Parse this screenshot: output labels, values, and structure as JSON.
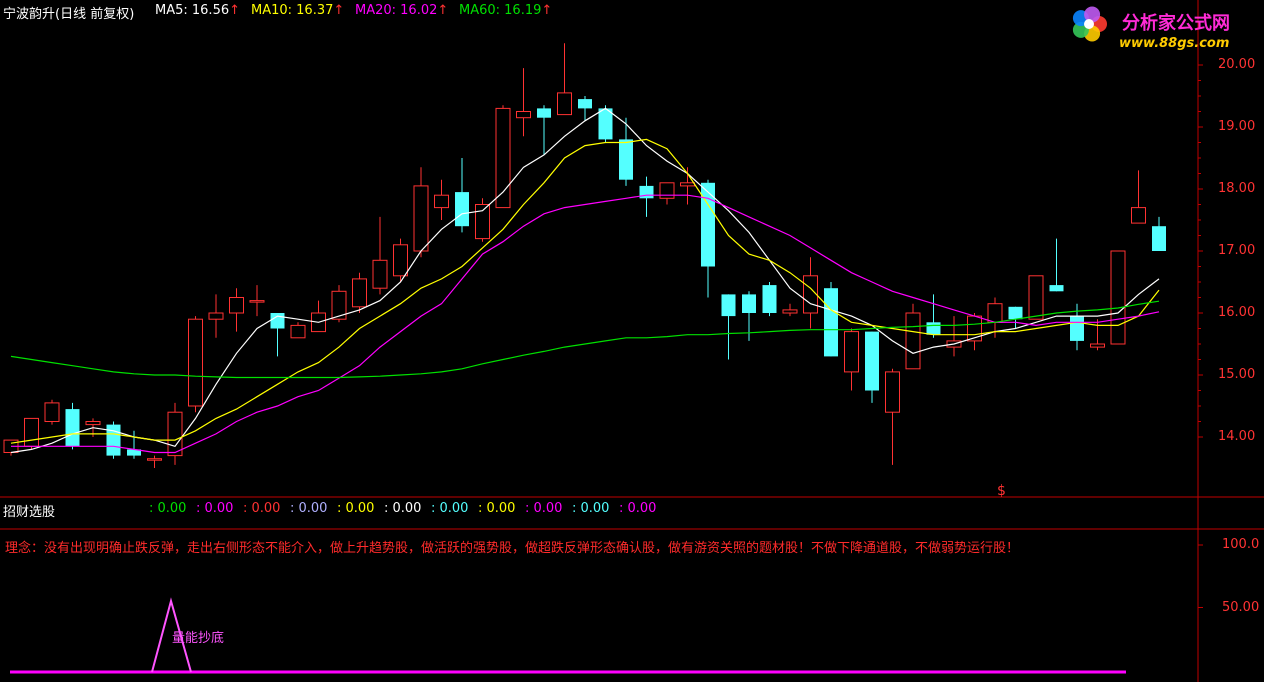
{
  "header": {
    "title": "宁波韵升(日线 前复权)",
    "ma5_label": "MA5: 16.56",
    "ma10_label": "MA10: 16.37",
    "ma20_label": "MA20: 16.02",
    "ma60_label": "MA60: 16.19",
    "arrow": "↑"
  },
  "colors": {
    "up": "#ff3232",
    "down": "#54ffff",
    "ma5": "#ffffff",
    "ma10": "#ffff00",
    "ma20": "#ff00ff",
    "ma60": "#00e000",
    "axis": "#c00000"
  },
  "watermark": {
    "brand": "分析家公式网",
    "url": "www.88gs.com"
  },
  "indicator": {
    "name": "招财选股",
    "values": [
      {
        "text": ": 0.00",
        "color": "#00e000"
      },
      {
        "text": ": 0.00",
        "color": "#ff00ff"
      },
      {
        "text": ": 0.00",
        "color": "#ff3232"
      },
      {
        "text": ": 0.00",
        "color": "#b0b0ff"
      },
      {
        "text": ": 0.00",
        "color": "#ffff00"
      },
      {
        "text": ": 0.00",
        "color": "#ffffff"
      },
      {
        "text": ": 0.00",
        "color": "#54ffff"
      },
      {
        "text": ": 0.00",
        "color": "#ffff00"
      },
      {
        "text": ": 0.00",
        "color": "#ff00ff"
      },
      {
        "text": ": 0.00",
        "color": "#54ffff"
      },
      {
        "text": ": 0.00",
        "color": "#ff00ff"
      }
    ],
    "note": "理念：没有出现明确止跌反弹，走出右侧形态不能介入，做上升趋势股，做活跃的强势股，做超跌反弹形态确认股，做有游资关照的题材股！不做下降通道股，不做弱势运行股！",
    "signal_label": "量能抄底",
    "marker": "$"
  },
  "chart_data": {
    "type": "candlestick",
    "title": "宁波韵升(日线 前复权)",
    "ylim": [
      13.5,
      20.2
    ],
    "yticks": [
      "20.00",
      "19.00",
      "18.00",
      "17.00",
      "16.00",
      "15.00",
      "14.00"
    ],
    "candles": [
      {
        "o": 13.75,
        "h": 13.95,
        "l": 13.7,
        "c": 13.95
      },
      {
        "o": 13.85,
        "h": 14.3,
        "l": 13.8,
        "c": 14.3
      },
      {
        "o": 14.25,
        "h": 14.6,
        "l": 14.2,
        "c": 14.55
      },
      {
        "o": 14.45,
        "h": 14.55,
        "l": 13.8,
        "c": 13.85
      },
      {
        "o": 14.2,
        "h": 14.3,
        "l": 14.0,
        "c": 14.25
      },
      {
        "o": 14.2,
        "h": 14.25,
        "l": 13.65,
        "c": 13.7
      },
      {
        "o": 13.8,
        "h": 14.1,
        "l": 13.65,
        "c": 13.7
      },
      {
        "o": 13.65,
        "h": 13.7,
        "l": 13.5,
        "c": 13.65
      },
      {
        "o": 13.7,
        "h": 14.55,
        "l": 13.55,
        "c": 14.4
      },
      {
        "o": 14.5,
        "h": 15.95,
        "l": 14.4,
        "c": 15.9
      },
      {
        "o": 15.9,
        "h": 16.3,
        "l": 15.6,
        "c": 16.0
      },
      {
        "o": 16.0,
        "h": 16.4,
        "l": 15.7,
        "c": 16.25
      },
      {
        "o": 16.2,
        "h": 16.45,
        "l": 15.95,
        "c": 16.2
      },
      {
        "o": 16.0,
        "h": 16.0,
        "l": 15.3,
        "c": 15.75
      },
      {
        "o": 15.6,
        "h": 15.85,
        "l": 15.6,
        "c": 15.8
      },
      {
        "o": 15.7,
        "h": 16.2,
        "l": 15.7,
        "c": 16.0
      },
      {
        "o": 15.9,
        "h": 16.45,
        "l": 15.85,
        "c": 16.35
      },
      {
        "o": 16.1,
        "h": 16.65,
        "l": 16.0,
        "c": 16.55
      },
      {
        "o": 16.4,
        "h": 17.55,
        "l": 16.3,
        "c": 16.85
      },
      {
        "o": 16.6,
        "h": 17.2,
        "l": 16.5,
        "c": 17.1
      },
      {
        "o": 17.0,
        "h": 18.35,
        "l": 16.9,
        "c": 18.05
      },
      {
        "o": 17.7,
        "h": 18.15,
        "l": 17.5,
        "c": 17.9
      },
      {
        "o": 17.95,
        "h": 18.5,
        "l": 17.3,
        "c": 17.4
      },
      {
        "o": 17.2,
        "h": 17.85,
        "l": 17.15,
        "c": 17.75
      },
      {
        "o": 17.7,
        "h": 19.35,
        "l": 17.7,
        "c": 19.3
      },
      {
        "o": 19.15,
        "h": 19.95,
        "l": 18.85,
        "c": 19.25
      },
      {
        "o": 19.3,
        "h": 19.35,
        "l": 18.55,
        "c": 19.15
      },
      {
        "o": 19.2,
        "h": 20.35,
        "l": 19.2,
        "c": 19.55
      },
      {
        "o": 19.45,
        "h": 19.5,
        "l": 19.1,
        "c": 19.3
      },
      {
        "o": 19.3,
        "h": 19.35,
        "l": 18.75,
        "c": 18.8
      },
      {
        "o": 18.8,
        "h": 19.15,
        "l": 18.05,
        "c": 18.15
      },
      {
        "o": 18.05,
        "h": 18.2,
        "l": 17.55,
        "c": 17.85
      },
      {
        "o": 17.85,
        "h": 18.1,
        "l": 17.75,
        "c": 18.1
      },
      {
        "o": 18.05,
        "h": 18.35,
        "l": 17.75,
        "c": 18.1
      },
      {
        "o": 18.1,
        "h": 18.15,
        "l": 16.25,
        "c": 16.75
      },
      {
        "o": 16.3,
        "h": 16.3,
        "l": 15.25,
        "c": 15.95
      },
      {
        "o": 16.3,
        "h": 16.35,
        "l": 15.55,
        "c": 16.0
      },
      {
        "o": 16.45,
        "h": 16.5,
        "l": 15.95,
        "c": 16.0
      },
      {
        "o": 16.0,
        "h": 16.15,
        "l": 15.95,
        "c": 16.05
      },
      {
        "o": 16.0,
        "h": 16.9,
        "l": 15.75,
        "c": 16.6
      },
      {
        "o": 16.4,
        "h": 16.5,
        "l": 15.3,
        "c": 15.3
      },
      {
        "o": 15.05,
        "h": 15.75,
        "l": 14.75,
        "c": 15.7
      },
      {
        "o": 15.7,
        "h": 15.7,
        "l": 14.55,
        "c": 14.75
      },
      {
        "o": 14.4,
        "h": 15.1,
        "l": 13.55,
        "c": 15.05
      },
      {
        "o": 15.1,
        "h": 16.15,
        "l": 15.1,
        "c": 16.0
      },
      {
        "o": 15.85,
        "h": 16.3,
        "l": 15.6,
        "c": 15.65
      },
      {
        "o": 15.45,
        "h": 15.95,
        "l": 15.3,
        "c": 15.55
      },
      {
        "o": 15.55,
        "h": 16.0,
        "l": 15.4,
        "c": 15.95
      },
      {
        "o": 15.85,
        "h": 16.25,
        "l": 15.6,
        "c": 16.15
      },
      {
        "o": 16.1,
        "h": 16.1,
        "l": 15.75,
        "c": 15.9
      },
      {
        "o": 15.9,
        "h": 16.35,
        "l": 15.9,
        "c": 16.6
      },
      {
        "o": 16.45,
        "h": 17.2,
        "l": 16.35,
        "c": 16.35
      },
      {
        "o": 15.95,
        "h": 16.15,
        "l": 15.4,
        "c": 15.55
      },
      {
        "o": 15.45,
        "h": 15.9,
        "l": 15.4,
        "c": 15.5
      },
      {
        "o": 15.5,
        "h": 17.0,
        "l": 15.5,
        "c": 17.0
      },
      {
        "o": 17.45,
        "h": 18.3,
        "l": 17.45,
        "c": 17.7
      },
      {
        "o": 17.4,
        "h": 17.55,
        "l": 17.0,
        "c": 17.0
      }
    ],
    "series": [
      {
        "name": "MA5",
        "values": [
          13.75,
          13.8,
          13.9,
          14.05,
          14.15,
          14.1,
          14.0,
          13.95,
          13.85,
          14.3,
          14.85,
          15.35,
          15.75,
          15.95,
          15.9,
          15.85,
          15.95,
          16.05,
          16.2,
          16.5,
          17.0,
          17.35,
          17.6,
          17.65,
          17.95,
          18.35,
          18.55,
          18.85,
          19.1,
          19.3,
          19.05,
          18.7,
          18.45,
          18.25,
          17.95,
          17.65,
          17.3,
          16.85,
          16.4,
          16.15,
          16.05,
          15.95,
          15.8,
          15.55,
          15.35,
          15.45,
          15.5,
          15.6,
          15.7,
          15.75,
          15.85,
          15.95,
          15.95,
          15.95,
          16.0,
          16.3,
          16.55
        ]
      },
      {
        "name": "MA10",
        "values": [
          13.9,
          13.95,
          14.0,
          14.05,
          14.05,
          14.05,
          14.0,
          13.95,
          13.95,
          14.1,
          14.3,
          14.45,
          14.65,
          14.85,
          15.05,
          15.2,
          15.45,
          15.75,
          15.95,
          16.15,
          16.4,
          16.55,
          16.75,
          17.05,
          17.35,
          17.75,
          18.1,
          18.5,
          18.7,
          18.75,
          18.75,
          18.8,
          18.65,
          18.25,
          17.75,
          17.25,
          16.95,
          16.85,
          16.65,
          16.4,
          16.05,
          15.85,
          15.8,
          15.75,
          15.7,
          15.65,
          15.65,
          15.65,
          15.7,
          15.7,
          15.75,
          15.8,
          15.85,
          15.8,
          15.8,
          15.95,
          16.37
        ]
      },
      {
        "name": "MA20",
        "values": [
          13.85,
          13.85,
          13.85,
          13.85,
          13.85,
          13.85,
          13.8,
          13.75,
          13.75,
          13.9,
          14.05,
          14.25,
          14.4,
          14.5,
          14.65,
          14.75,
          14.95,
          15.15,
          15.45,
          15.7,
          15.95,
          16.15,
          16.55,
          16.95,
          17.15,
          17.4,
          17.6,
          17.7,
          17.75,
          17.8,
          17.85,
          17.9,
          17.9,
          17.9,
          17.85,
          17.7,
          17.55,
          17.4,
          17.25,
          17.05,
          16.85,
          16.65,
          16.5,
          16.35,
          16.25,
          16.15,
          16.05,
          15.95,
          15.85,
          15.85,
          15.8,
          15.85,
          15.85,
          15.85,
          15.9,
          15.95,
          16.02
        ]
      },
      {
        "name": "MA60",
        "values": [
          15.3,
          15.25,
          15.2,
          15.15,
          15.1,
          15.05,
          15.02,
          15.0,
          15.0,
          14.98,
          14.97,
          14.96,
          14.96,
          14.96,
          14.96,
          14.96,
          14.96,
          14.97,
          14.98,
          15.0,
          15.02,
          15.05,
          15.1,
          15.18,
          15.25,
          15.32,
          15.38,
          15.45,
          15.5,
          15.55,
          15.6,
          15.6,
          15.62,
          15.65,
          15.65,
          15.67,
          15.68,
          15.7,
          15.72,
          15.73,
          15.73,
          15.73,
          15.75,
          15.77,
          15.78,
          15.8,
          15.8,
          15.82,
          15.85,
          15.9,
          15.95,
          16.0,
          16.03,
          16.05,
          16.08,
          16.14,
          16.19
        ]
      }
    ],
    "indicator_yticks": [
      "100.0",
      "50.00"
    ],
    "indicator_ylim": [
      0,
      125
    ]
  }
}
